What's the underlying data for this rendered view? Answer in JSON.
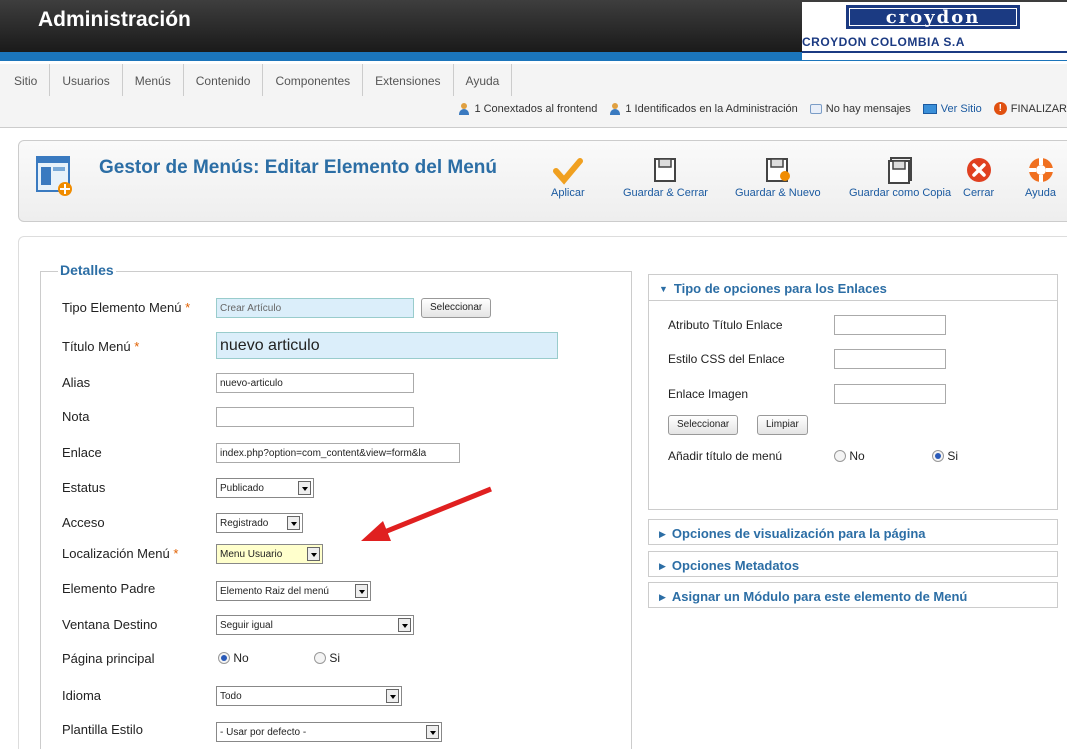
{
  "header": {
    "title": "Administración",
    "logo_name": "croydon",
    "logo_sub": "CROYDON COLOMBIA S.A"
  },
  "menu": [
    "Sitio",
    "Usuarios",
    "Menús",
    "Contenido",
    "Componentes",
    "Extensiones",
    "Ayuda"
  ],
  "status": {
    "frontend": "1 Conextados al frontend",
    "admin": "1 Identificados en la Administración",
    "messages": "No hay mensajes",
    "view_site": "Ver Sitio",
    "logout": "FINALIZAR"
  },
  "toolbar": {
    "title": "Gestor de Menús: Editar Elemento del Menú",
    "buttons": [
      "Aplicar",
      "Guardar & Cerrar",
      "Guardar & Nuevo",
      "Guardar como Copia",
      "Cerrar",
      "Ayuda"
    ]
  },
  "details": {
    "legend": "Detalles",
    "labels": {
      "tipo": "Tipo Elemento Menú",
      "titulo": "Título Menú",
      "alias": "Alias",
      "nota": "Nota",
      "enlace": "Enlace",
      "estatus": "Estatus",
      "acceso": "Acceso",
      "localizacion": "Localización Menú",
      "padre": "Elemento Padre",
      "ventana": "Ventana Destino",
      "principal": "Página principal",
      "idioma": "Idioma",
      "plantilla": "Plantilla Estilo"
    },
    "required_mark": "*",
    "values": {
      "tipo": "Crear Artículo",
      "titulo": "nuevo articulo",
      "alias": "nuevo-articulo",
      "nota": "",
      "enlace": "index.php?option=com_content&view=form&la",
      "estatus": "Publicado",
      "acceso": "Registrado",
      "localizacion": "Menu Usuario",
      "padre": "Elemento Raiz del menú",
      "ventana": "Seguir igual",
      "idioma": "Todo",
      "plantilla": "- Usar por defecto -"
    },
    "select_button": "Seleccionar",
    "radio_no": "No",
    "radio_si": "Si",
    "principal_selected": "No"
  },
  "right_panel": {
    "link_options": {
      "title": "Tipo de opciones para los Enlaces",
      "attr_title": "Atributo Título Enlace",
      "css_style": "Estilo CSS del Enlace",
      "image": "Enlace Imagen",
      "select_btn": "Seleccionar",
      "clear_btn": "Limpiar",
      "add_title": "Añadir título de menú",
      "no": "No",
      "si": "Si",
      "add_title_selected": "Si"
    },
    "collapsed": [
      "Opciones de visualización para la página",
      "Opciones Metadatos",
      "Asignar un Módulo para este elemento de Menú"
    ]
  },
  "colors": {
    "accent": "#2c6ea5",
    "header": "#222222",
    "strip": "#1b75bb",
    "arrow": "#e02020"
  }
}
